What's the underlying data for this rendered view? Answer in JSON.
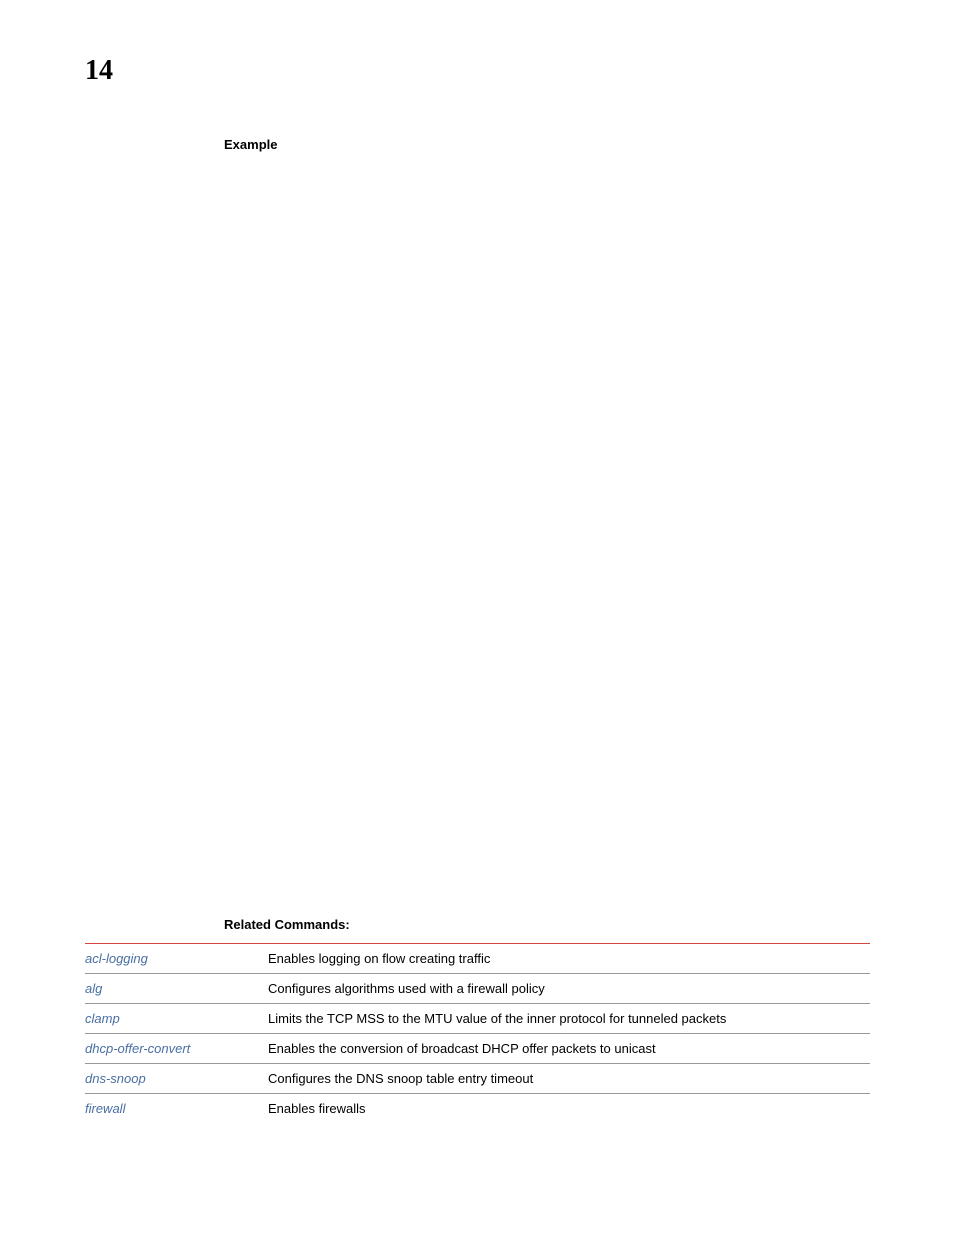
{
  "page_number": "14",
  "headings": {
    "example": "Example",
    "related": "Related Commands:"
  },
  "related_commands": [
    {
      "name": "acl-logging",
      "desc": "Enables logging on flow creating traffic"
    },
    {
      "name": "alg",
      "desc": "Configures algorithms used with a firewall policy"
    },
    {
      "name": "clamp",
      "desc": "Limits the TCP MSS to the MTU value of the inner protocol for tunneled packets"
    },
    {
      "name": "dhcp-offer-convert",
      "desc": "Enables the conversion of broadcast DHCP offer packets to unicast"
    },
    {
      "name": "dns-snoop",
      "desc": "Configures the DNS snoop table entry timeout"
    },
    {
      "name": "firewall",
      "desc": "Enables firewalls"
    }
  ]
}
